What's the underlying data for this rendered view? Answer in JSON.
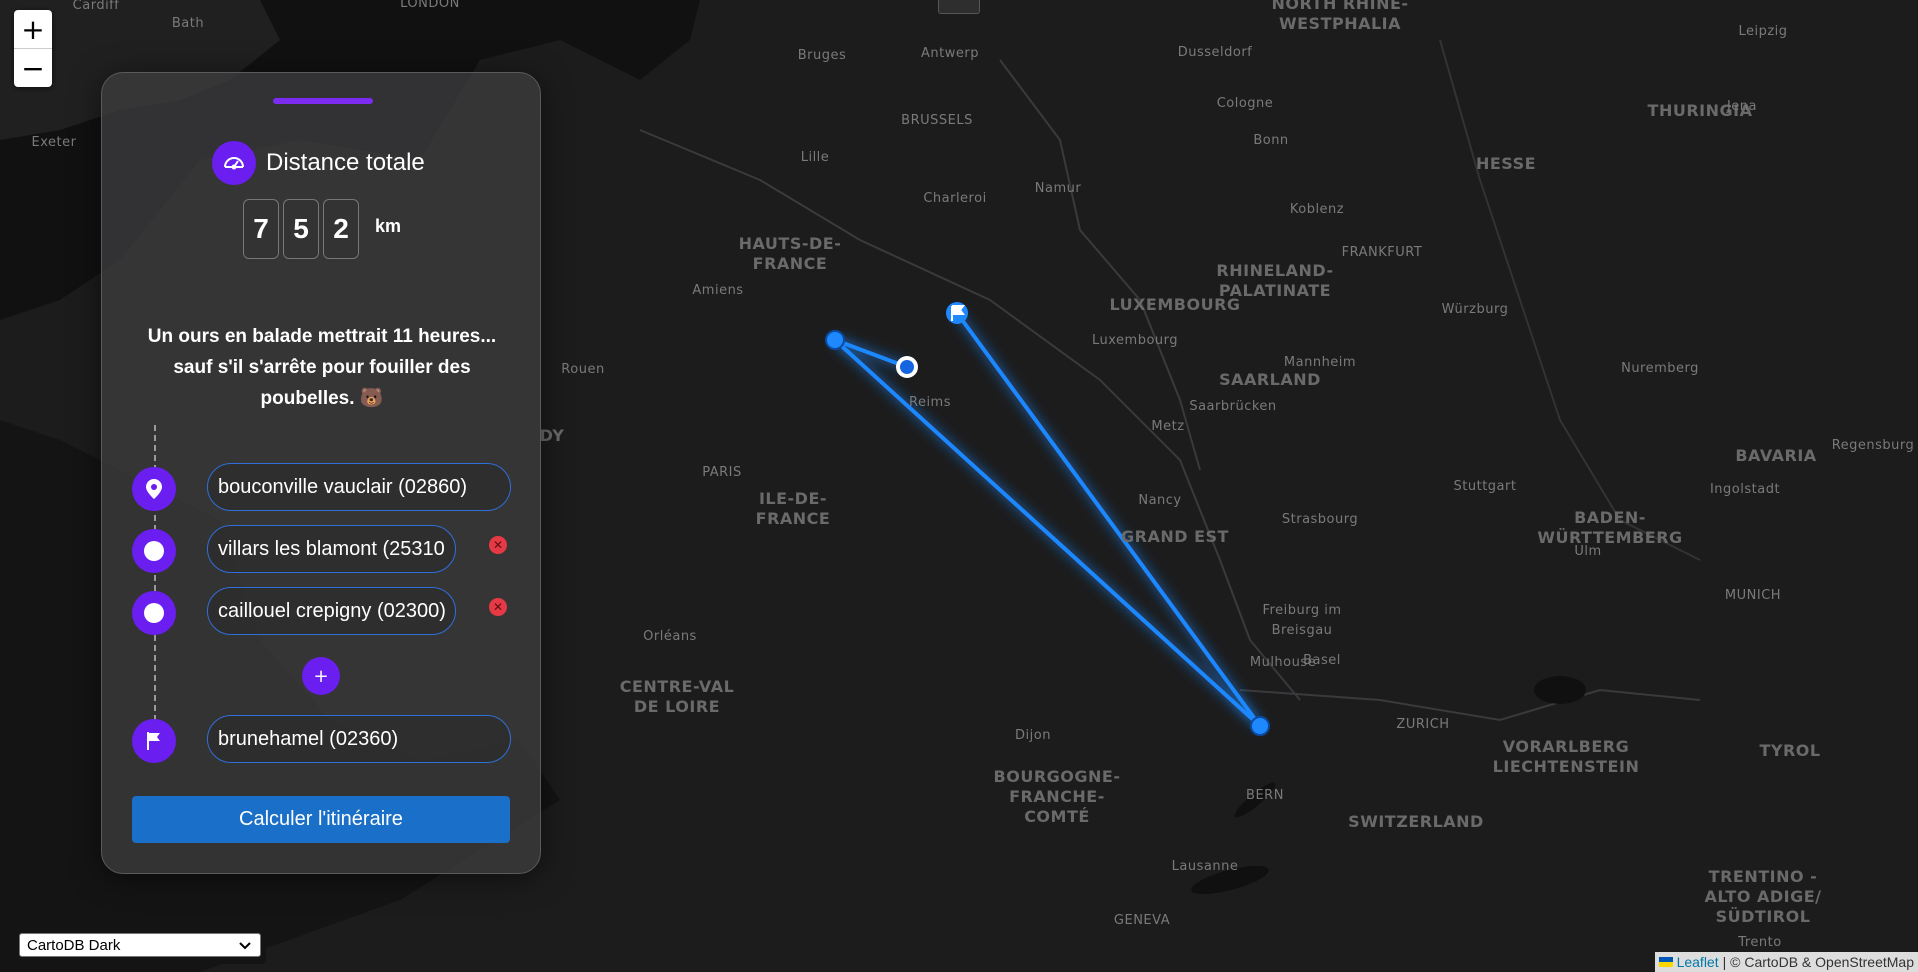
{
  "map": {
    "labels": [
      {
        "text": "NORTH RHINE-\nWESTPHALIA",
        "kind": "region"
      },
      {
        "text": "THURINGIA",
        "kind": "region"
      },
      {
        "text": "HESSE",
        "kind": "region"
      },
      {
        "text": "BRUSSELS",
        "kind": "city"
      },
      {
        "text": "Antwerp",
        "kind": "city"
      },
      {
        "text": "Bruges",
        "kind": "city"
      },
      {
        "text": "Lille",
        "kind": "city"
      },
      {
        "text": "Charleroi",
        "kind": "city"
      },
      {
        "text": "Namur",
        "kind": "city"
      },
      {
        "text": "Dusseldorf",
        "kind": "city"
      },
      {
        "text": "Cologne",
        "kind": "city"
      },
      {
        "text": "Bonn",
        "kind": "city"
      },
      {
        "text": "Koblenz",
        "kind": "city"
      },
      {
        "text": "FRANKFURT",
        "kind": "city"
      },
      {
        "text": "Jena",
        "kind": "city"
      },
      {
        "text": "Leipzig",
        "kind": "city"
      },
      {
        "text": "HAUTS-DE-\nFRANCE",
        "kind": "region"
      },
      {
        "text": "RHINELAND-\nPALATINATE",
        "kind": "region"
      },
      {
        "text": "LUXEMBOURG",
        "kind": "region"
      },
      {
        "text": "Luxembourg",
        "kind": "city"
      },
      {
        "text": "Amiens",
        "kind": "city"
      },
      {
        "text": "Rouen",
        "kind": "city"
      },
      {
        "text": "Reims",
        "kind": "city"
      },
      {
        "text": "SAARLAND",
        "kind": "region"
      },
      {
        "text": "Saarbrücken",
        "kind": "city"
      },
      {
        "text": "Mannheim",
        "kind": "city"
      },
      {
        "text": "Würzburg",
        "kind": "city"
      },
      {
        "text": "Nuremberg",
        "kind": "city"
      },
      {
        "text": "BAVARIA",
        "kind": "region"
      },
      {
        "text": "Regensburg",
        "kind": "city"
      },
      {
        "text": "Ingolstadt",
        "kind": "city"
      },
      {
        "text": "Metz",
        "kind": "city"
      },
      {
        "text": "PARIS",
        "kind": "city"
      },
      {
        "text": "ILE-DE-\nFRANCE",
        "kind": "region"
      },
      {
        "text": "Nancy",
        "kind": "city"
      },
      {
        "text": "GRAND EST",
        "kind": "region"
      },
      {
        "text": "Strasbourg",
        "kind": "city"
      },
      {
        "text": "Stuttgart",
        "kind": "city"
      },
      {
        "text": "BADEN-\nWÜRTTEMBERG",
        "kind": "region"
      },
      {
        "text": "Ulm",
        "kind": "city"
      },
      {
        "text": "MUNICH",
        "kind": "city"
      },
      {
        "text": "Freiburg im\nBreisgau",
        "kind": "city"
      },
      {
        "text": "Orléans",
        "kind": "city"
      },
      {
        "text": "CENTRE-VAL\nDE LOIRE",
        "kind": "region"
      },
      {
        "text": "Mulhouse",
        "kind": "city"
      },
      {
        "text": "Basel",
        "kind": "city"
      },
      {
        "text": "ZURICH",
        "kind": "city"
      },
      {
        "text": "VORARLBERG\nLIECHTENSTEIN",
        "kind": "region"
      },
      {
        "text": "TYROL",
        "kind": "region"
      },
      {
        "text": "Dijon",
        "kind": "city"
      },
      {
        "text": "BOURGOGNE-\nFRANCHE-\nCOMTÉ",
        "kind": "region"
      },
      {
        "text": "BERN",
        "kind": "city"
      },
      {
        "text": "SWITZERLAND",
        "kind": "region"
      },
      {
        "text": "Lausanne",
        "kind": "city"
      },
      {
        "text": "GENEVA",
        "kind": "city"
      },
      {
        "text": "TRENTINO -\nALTO ADIGE/\nSÜDTIROL",
        "kind": "region"
      },
      {
        "text": "Trento",
        "kind": "city"
      },
      {
        "text": "Exeter",
        "kind": "city"
      },
      {
        "text": "Bath",
        "kind": "city"
      },
      {
        "text": "Cardiff",
        "kind": "city"
      },
      {
        "text": "LONDON",
        "kind": "city"
      },
      {
        "text": "DY",
        "kind": "region"
      }
    ],
    "route_color": "#1e88ff",
    "glow_color": "#00e5ff"
  },
  "zoom": {
    "in": "+",
    "out": "−"
  },
  "panel": {
    "title": "Distance totale",
    "digits": [
      "7",
      "5",
      "2"
    ],
    "unit": "km",
    "quote": "Un ours en balade mettrait 11 heures... sauf s'il s'arrête pour fouiller des poubelles. 🐻",
    "stops": [
      {
        "value": "bouconville vauclair (02860)",
        "icon": "map-pin-icon",
        "removable": false
      },
      {
        "value": "villars les blamont (25310",
        "icon": "dot-icon",
        "removable": true
      },
      {
        "value": "caillouel crepigny (02300)",
        "icon": "dot-icon",
        "removable": true
      },
      {
        "value": "brunehamel (02360)",
        "icon": "flag-icon",
        "removable": false
      }
    ],
    "add_label": "+",
    "calc_label": "Calculer l'itinéraire",
    "accent": "#6a1ef0"
  },
  "basemap": {
    "selected": "CartoDB Dark"
  },
  "attribution": {
    "leaflet": "Leaflet",
    "rest": "| © CartoDB & OpenStreetMap"
  }
}
